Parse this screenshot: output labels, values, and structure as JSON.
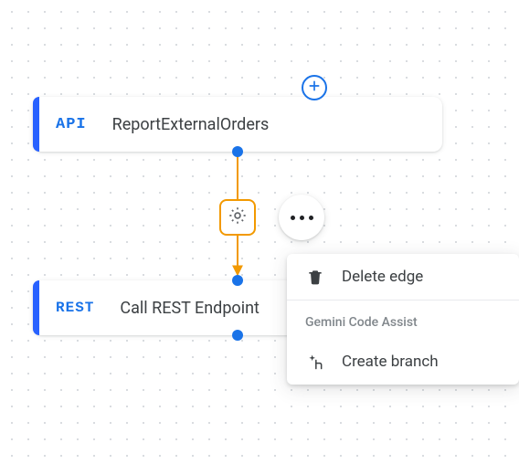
{
  "nodes": {
    "api": {
      "tag": "API",
      "title": "ReportExternalOrders"
    },
    "rest": {
      "tag": "REST",
      "title": "Call REST Endpoint"
    }
  },
  "contextMenu": {
    "delete": "Delete edge",
    "sectionHeader": "Gemini Code Assist",
    "createBranch": "Create branch"
  },
  "icons": {
    "add": "plus-circle",
    "gear": "settings-gear",
    "kebab": "more-horizontal",
    "trash": "delete",
    "sparkBranch": "create-branch"
  }
}
